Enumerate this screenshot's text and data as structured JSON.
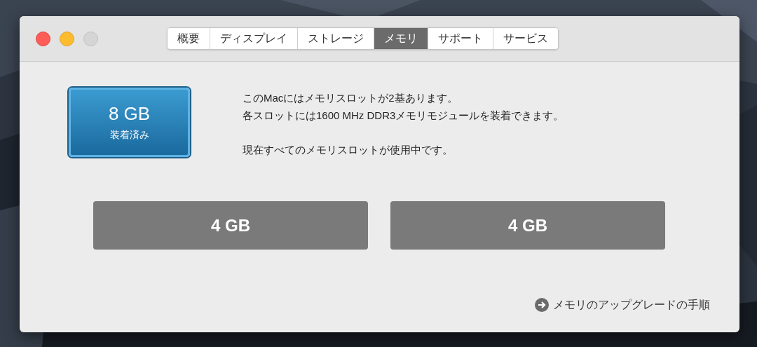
{
  "window": {
    "tabs": [
      {
        "label": "概要",
        "selected": false
      },
      {
        "label": "ディスプレイ",
        "selected": false
      },
      {
        "label": "ストレージ",
        "selected": false
      },
      {
        "label": "メモリ",
        "selected": true
      },
      {
        "label": "サポート",
        "selected": false
      },
      {
        "label": "サービス",
        "selected": false
      }
    ],
    "summary": {
      "amount": "8 GB",
      "status": "装着済み"
    },
    "description": [
      "このMacにはメモリスロットが2基あります。",
      "各スロットには1600 MHz DDR3メモリモジュールを装着できます。"
    ],
    "status_text": "現在すべてのメモリスロットが使用中です。",
    "slots": [
      "4 GB",
      "4 GB"
    ],
    "link": "メモリのアップグレードの手順"
  }
}
